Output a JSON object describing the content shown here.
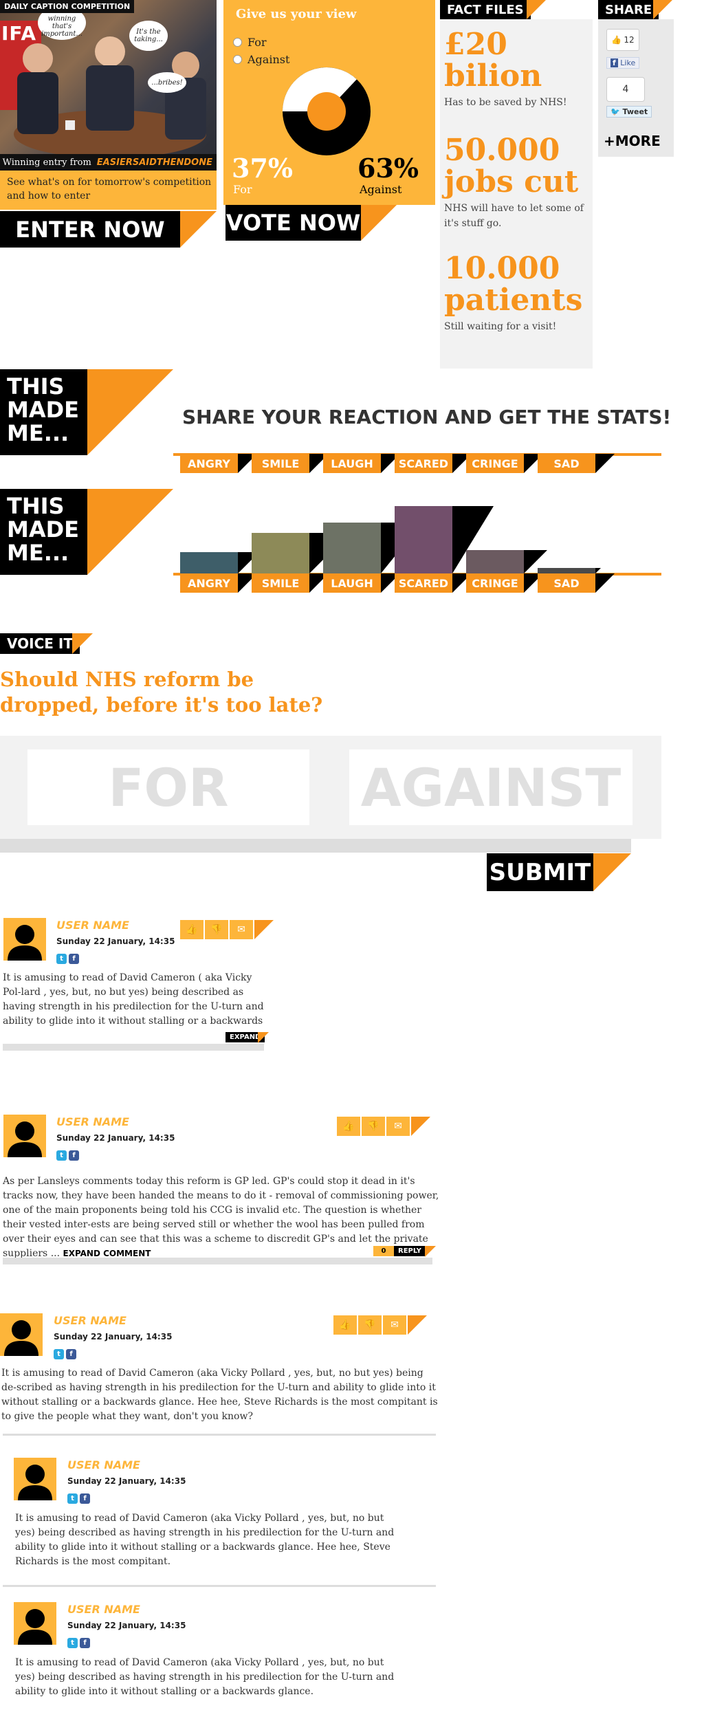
{
  "caption": {
    "label": "DAILY CAPTION COMPETITION",
    "bubble1": "It's not the winning that's important...",
    "bubble2": "It's the taking...",
    "bubble3": "...bribes!",
    "photo_text": "IFA",
    "winner_prefix": "Winning entry from",
    "winner_name": "EASIERSAIDTHENDONE",
    "desc": "See what's on for tomorrow's competition and how to enter",
    "button": "ENTER NOW"
  },
  "poll": {
    "title": "Give us your view",
    "options": [
      "For",
      "Against"
    ],
    "for_pct": "37%",
    "for_label": "For",
    "against_pct": "63%",
    "against_label": "Against",
    "for_value": 37,
    "button": "VOTE NOW"
  },
  "facts": {
    "header": "FACT FILES",
    "items": [
      {
        "big1": "£20",
        "big2": "bilion",
        "sub": "Has to be saved by NHS!"
      },
      {
        "big1": "50.000",
        "big2": "jobs cut",
        "sub": "NHS will have to let some of it's stuff go."
      },
      {
        "big1": "10.000",
        "big2": "patients",
        "sub": "Still waiting for a visit!"
      }
    ]
  },
  "share": {
    "header": "SHARE",
    "like_count": "12",
    "like_label": "Like",
    "tweet_count": "4",
    "tweet_label": "Tweet",
    "more": "+MORE"
  },
  "reactions": {
    "badge_lines": [
      "THIS",
      "MADE",
      "ME..."
    ],
    "heading": "SHARE YOUR REACTION AND GET THE STATS!",
    "buttons": [
      "ANGRY",
      "SMILE",
      "LAUGH",
      "SCARED",
      "CRINGE",
      "SAD"
    ],
    "colors": [
      "#3E5E69",
      "#8D8A58",
      "#6D7265",
      "#724F6B",
      "#6B5A60",
      "#4A4A4A"
    ],
    "levels": [
      0.32,
      0.6,
      0.75,
      1.0,
      0.35,
      0.08
    ]
  },
  "voice": {
    "header": "VOICE IT",
    "question_line1": "Should NHS reform be",
    "question_line2": "dropped, before it's too late?",
    "for": "FOR",
    "against": "AGAINST",
    "submit": "SUBMIT"
  },
  "comments": [
    {
      "user": "USER NAME",
      "date": "Sunday 22 January, 14:35",
      "text": "It is amusing to read of David Cameron ( aka Vicky Pol-lard , yes, but, no  but yes) being described as having strength in his predilection for the U-turn and ability to glide into it without stalling or a backwards",
      "expand": "EXPAND"
    },
    {
      "user": "USER NAME",
      "date": "Sunday 22 January, 14:35",
      "text": "As per Lansleys comments today this reform is GP led. GP's could stop it dead in it's tracks now,  they have been handed the means to do it - removal of commissioning power, one of the main proponents being told his CCG is invalid etc. The question is whether their vested inter-ests are being served still or whether the wool has been pulled from over their eyes and can see that this was a scheme to discredit GP's and let the private suppliers ...",
      "expand": "EXPAND COMMENT",
      "reply_count": "0",
      "reply": "REPLY"
    },
    {
      "user": "USER NAME",
      "date": "Sunday 22 January, 14:35",
      "text": "It is amusing to read of David Cameron (aka Vicky Pollard , yes, but, no  but yes) being de-scribed as having strength in his predilection for the U-turn and ability to glide into it without stalling or a backwards glance. Hee hee, Steve Richards is the most compitant is to give the people what they want, don't you  know?"
    },
    {
      "user": "USER NAME",
      "date": "Sunday 22 January, 14:35",
      "text": "It is amusing to read of David Cameron (aka Vicky Pollard , yes, but, no  but yes) being described as having strength in his predilection for the U-turn and ability to glide into it without stalling or a backwards glance. Hee hee, Steve Richards is the most compitant."
    },
    {
      "user": "USER NAME",
      "date": "Sunday 22 January, 14:35",
      "text": "It is amusing to read of David Cameron (aka Vicky Pollard , yes, but, no  but yes) being described as having strength in his predilection for the U-turn and ability to glide into it without stalling or a backwards glance."
    }
  ]
}
